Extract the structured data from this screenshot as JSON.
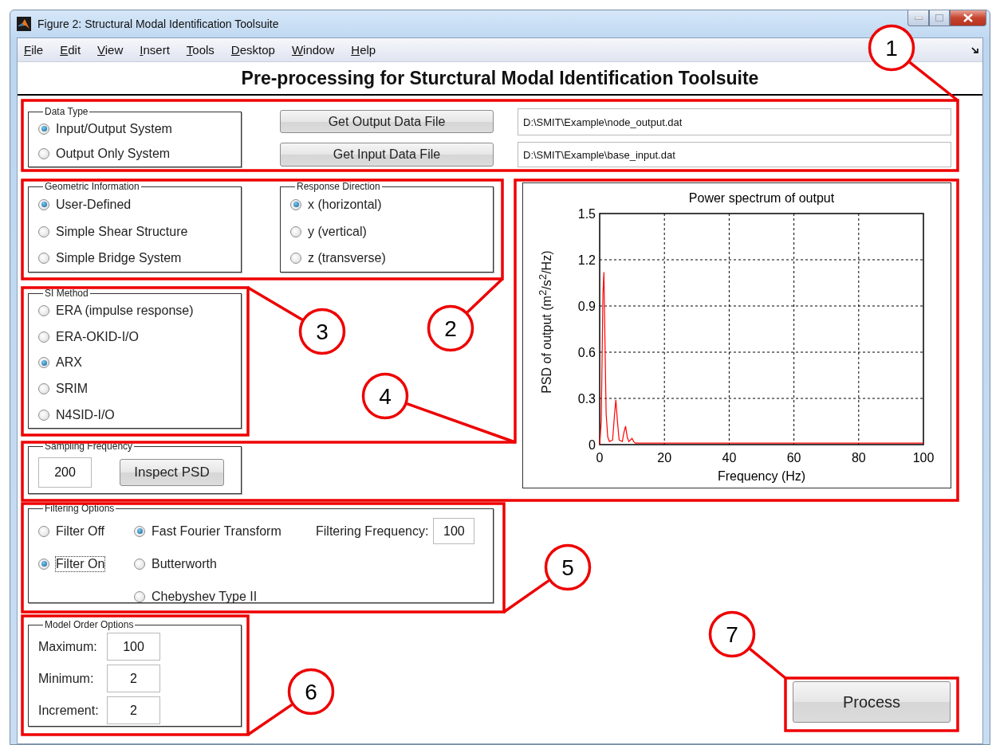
{
  "window": {
    "title": "Figure 2: Structural Modal Identification Toolsuite"
  },
  "menu": [
    {
      "label": "File"
    },
    {
      "label": "Edit"
    },
    {
      "label": "View"
    },
    {
      "label": "Insert"
    },
    {
      "label": "Tools"
    },
    {
      "label": "Desktop"
    },
    {
      "label": "Window"
    },
    {
      "label": "Help"
    }
  ],
  "heading": "Pre-processing for Sturctural Modal Identification Toolsuite",
  "data_type": {
    "legend": "Data Type",
    "options": [
      {
        "label": "Input/Output System",
        "selected": true
      },
      {
        "label": "Output Only System",
        "selected": false
      }
    ],
    "output_button": "Get Output Data File",
    "input_button": "Get Input Data File",
    "output_path": "D:\\SMIT\\Example\\node_output.dat",
    "input_path": "D:\\SMIT\\Example\\base_input.dat"
  },
  "geometric": {
    "legend": "Geometric Information",
    "options": [
      {
        "label": "User-Defined",
        "selected": true
      },
      {
        "label": "Simple Shear Structure",
        "selected": false
      },
      {
        "label": "Simple Bridge System",
        "selected": false
      }
    ]
  },
  "response_direction": {
    "legend": "Response Direction",
    "options": [
      {
        "label": "x (horizontal)",
        "selected": true
      },
      {
        "label": "y (vertical)",
        "selected": false
      },
      {
        "label": "z (transverse)",
        "selected": false
      }
    ]
  },
  "si_method": {
    "legend": "SI Method",
    "options": [
      {
        "label": "ERA (impulse response)",
        "selected": false
      },
      {
        "label": "ERA-OKID-I/O",
        "selected": false
      },
      {
        "label": "ARX",
        "selected": true
      },
      {
        "label": "SRIM",
        "selected": false
      },
      {
        "label": "N4SID-I/O",
        "selected": false
      }
    ]
  },
  "sampling": {
    "legend": "Sampling Frequency",
    "value": "200",
    "button": "Inspect PSD"
  },
  "plot": {
    "chart_data": {
      "type": "line",
      "title": "Power spectrum of output",
      "xlabel": "Frequency (Hz)",
      "ylabel": "PSD of output (m$^{2}$/s$^{2}$/Hz)",
      "x": [
        0,
        0.5,
        1,
        1.3,
        1.6,
        2,
        2.5,
        3,
        4,
        4.6,
        5,
        5.5,
        6,
        7,
        7.5,
        8,
        8.5,
        9,
        10,
        10.5,
        11,
        20,
        40,
        60,
        80,
        100
      ],
      "series": [
        {
          "color": "#ff0000",
          "values": [
            0,
            0.15,
            0.98,
            1.12,
            0.72,
            0.2,
            0.05,
            0.02,
            0.03,
            0.2,
            0.29,
            0.15,
            0.03,
            0.02,
            0.08,
            0.12,
            0.05,
            0.02,
            0.04,
            0.02,
            0.01,
            0.01,
            0.01,
            0.01,
            0.01,
            0.01
          ]
        }
      ],
      "grid": true,
      "xlim": [
        0,
        100
      ],
      "ylim": [
        0,
        1.5
      ],
      "xticks": [
        0,
        20,
        40,
        60,
        80,
        100
      ],
      "yticks": [
        0,
        0.3,
        0.6,
        0.9,
        1.2,
        1.5
      ]
    }
  },
  "filtering": {
    "legend": "Filtering Options",
    "filter": [
      {
        "label": "Filter Off",
        "selected": false,
        "focused": false
      },
      {
        "label": "Filter On",
        "selected": true,
        "focused": true
      }
    ],
    "method": [
      {
        "label": "Fast Fourier Transform",
        "selected": true
      },
      {
        "label": "Butterworth",
        "selected": false
      },
      {
        "label": "Chebyshev Type II",
        "selected": false
      }
    ],
    "frequency_label": "Filtering Frequency:",
    "frequency_value": "100"
  },
  "model_order": {
    "legend": "Model Order Options",
    "fields": [
      {
        "label": "Maximum:",
        "value": "100"
      },
      {
        "label": "Minimum:",
        "value": "2"
      },
      {
        "label": "Increment:",
        "value": "2"
      }
    ]
  },
  "process_button": "Process",
  "callouts": [
    {
      "label": "1"
    },
    {
      "label": "2"
    },
    {
      "label": "3"
    },
    {
      "label": "4"
    },
    {
      "label": "5"
    },
    {
      "label": "6"
    },
    {
      "label": "7"
    }
  ]
}
